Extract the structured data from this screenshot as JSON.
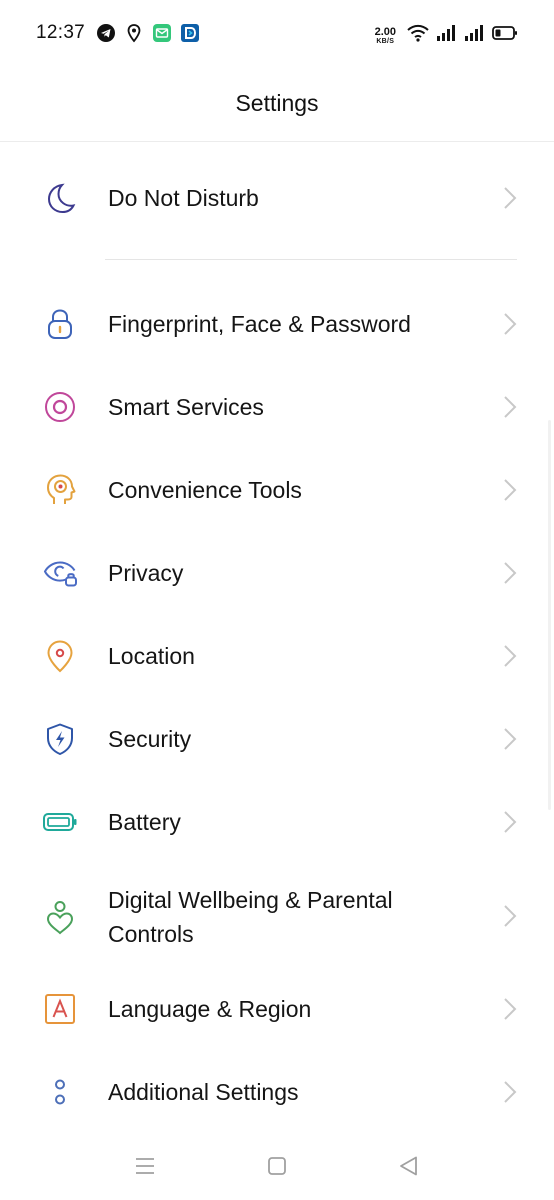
{
  "status": {
    "time": "12:37",
    "net_speed_value": "2.00",
    "net_speed_unit": "KB/S",
    "icons": [
      "telegram-icon",
      "location-pin-icon",
      "messages-icon",
      "app-d-icon",
      "wifi-icon",
      "signal-1-icon",
      "signal-2-icon",
      "battery-icon"
    ]
  },
  "header": {
    "title": "Settings"
  },
  "items": [
    {
      "label": "Do Not Disturb",
      "icon": "moon-icon"
    },
    {
      "label": "Fingerprint, Face & Password",
      "icon": "lock-icon"
    },
    {
      "label": "Smart Services",
      "icon": "target-ring-icon"
    },
    {
      "label": "Convenience Tools",
      "icon": "head-gear-icon"
    },
    {
      "label": "Privacy",
      "icon": "eye-lock-icon"
    },
    {
      "label": "Location",
      "icon": "location-icon"
    },
    {
      "label": "Security",
      "icon": "shield-bolt-icon"
    },
    {
      "label": "Battery",
      "icon": "battery-icon"
    },
    {
      "label": "Digital Wellbeing & Parental Controls",
      "icon": "person-heart-icon"
    },
    {
      "label": "Language & Region",
      "icon": "letter-a-icon"
    },
    {
      "label": "Additional Settings",
      "icon": "dots-icon"
    }
  ],
  "nav": {
    "icons": [
      "menu-icon",
      "home-square-icon",
      "back-triangle-icon"
    ]
  },
  "colors": {
    "moon": "#3d3a8f",
    "lock": "#3e64b8",
    "smart": "#c0479a",
    "tools": "#e3a23e",
    "privacy": "#4a6bc4",
    "location": "#e6a33f",
    "security": "#2f56a8",
    "battery": "#1fa99a",
    "wellbeing": "#4aa15b",
    "language": "#e6943a",
    "additional": "#4d6fb8",
    "chevron": "#c8c8c8"
  }
}
